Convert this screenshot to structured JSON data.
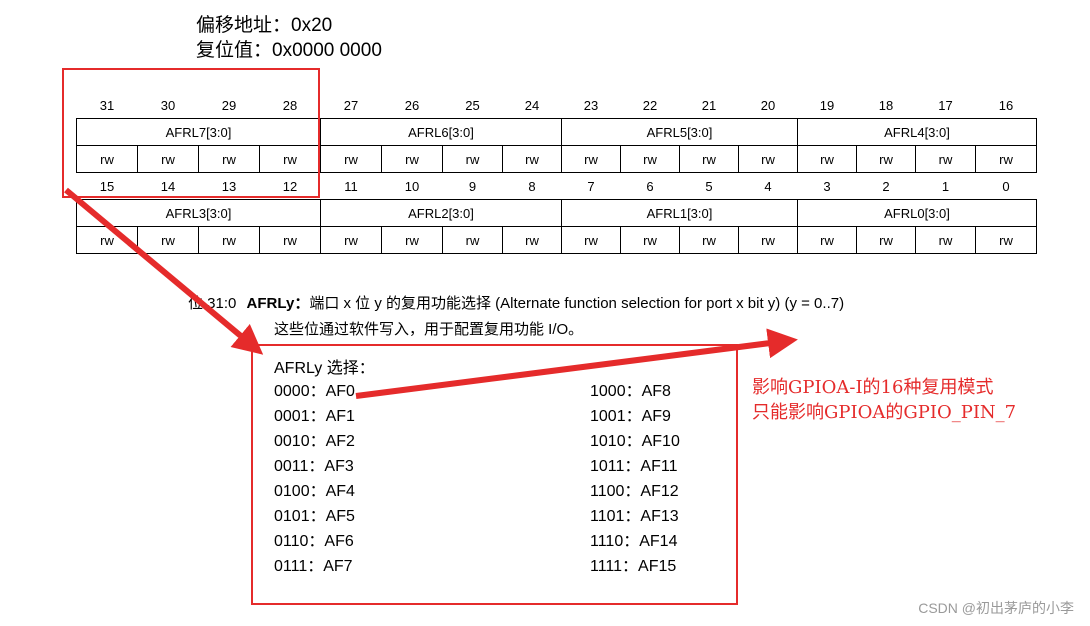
{
  "header": {
    "offset": "偏移地址：0x20",
    "reset": "复位值：0x0000 0000"
  },
  "register": {
    "row_high_bits": [
      "31",
      "30",
      "29",
      "28",
      "27",
      "26",
      "25",
      "24",
      "23",
      "22",
      "21",
      "20",
      "19",
      "18",
      "17",
      "16"
    ],
    "row_high_fields": [
      "AFRL7[3:0]",
      "AFRL6[3:0]",
      "AFRL5[3:0]",
      "AFRL4[3:0]"
    ],
    "row_low_bits": [
      "15",
      "14",
      "13",
      "12",
      "11",
      "10",
      "9",
      "8",
      "7",
      "6",
      "5",
      "4",
      "3",
      "2",
      "1",
      "0"
    ],
    "row_low_fields": [
      "AFRL3[3:0]",
      "AFRL2[3:0]",
      "AFRL1[3:0]",
      "AFRL0[3:0]"
    ],
    "access": "rw"
  },
  "description": {
    "bits_prefix": "位 31:0",
    "field_name": "AFRLy：",
    "line1_rest": "端口 x 位 y 的复用功能选择 (Alternate function selection for port x bit y) (y = 0..7)",
    "line2": "这些位通过软件写入，用于配置复用功能 I/O。"
  },
  "selection": {
    "title": "AFRLy 选择：",
    "left": [
      "0000：AF0",
      "0001：AF1",
      "0010：AF2",
      "0011：AF3",
      "0100：AF4",
      "0101：AF5",
      "0110：AF6",
      "0111：AF7"
    ],
    "right": [
      "1000：AF8",
      "1001：AF9",
      "1010：AF10",
      "1011：AF11",
      "1100：AF12",
      "1101：AF13",
      "1110：AF14",
      "1111：AF15"
    ]
  },
  "annotation": {
    "line1": "影响GPIOA-I的16种复用模式",
    "line2": "只能影响GPIOA的GPIO_PIN_7",
    "color": "#e52b2b"
  },
  "watermark": "CSDN @初出茅庐的小李"
}
